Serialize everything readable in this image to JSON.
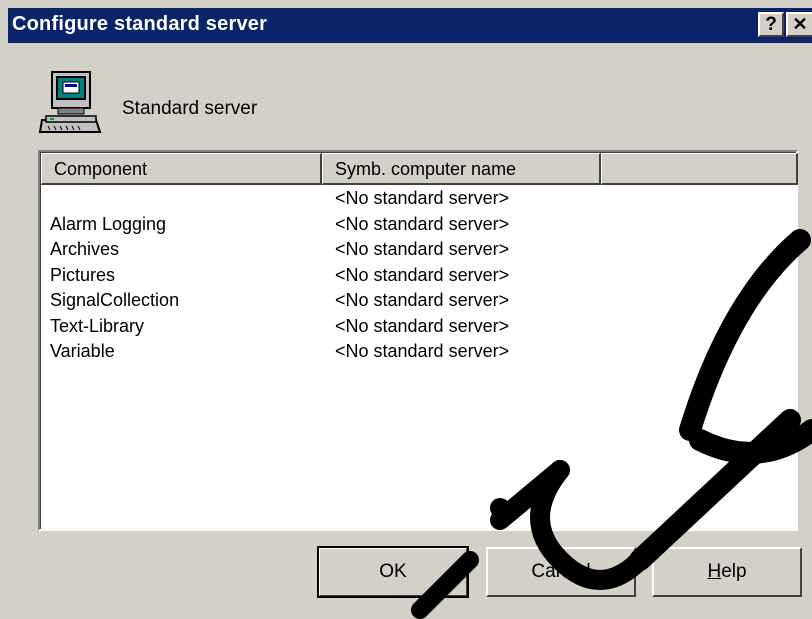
{
  "window": {
    "title": "Configure standard server",
    "help_glyph": "?",
    "close_glyph": "✕"
  },
  "header": {
    "label": "Standard server",
    "icon": "computer-icon"
  },
  "list": {
    "columns": [
      "Component",
      "Symb. computer name",
      ""
    ],
    "rows": [
      {
        "component": "",
        "server": "<No standard server>"
      },
      {
        "component": "Alarm Logging",
        "server": "<No standard server>"
      },
      {
        "component": "Archives",
        "server": "<No standard server>"
      },
      {
        "component": "Pictures",
        "server": "<No standard server>"
      },
      {
        "component": "SignalCollection",
        "server": "<No standard server>"
      },
      {
        "component": "Text-Library",
        "server": "<No standard server>"
      },
      {
        "component": "Variable",
        "server": "<No standard server>"
      }
    ]
  },
  "buttons": {
    "ok": "OK",
    "cancel": "Cancel",
    "help_first": "H",
    "help_rest": "elp"
  },
  "colors": {
    "titlebar": "#0a246a",
    "face": "#d4d0c8",
    "watermark": "#000000"
  }
}
